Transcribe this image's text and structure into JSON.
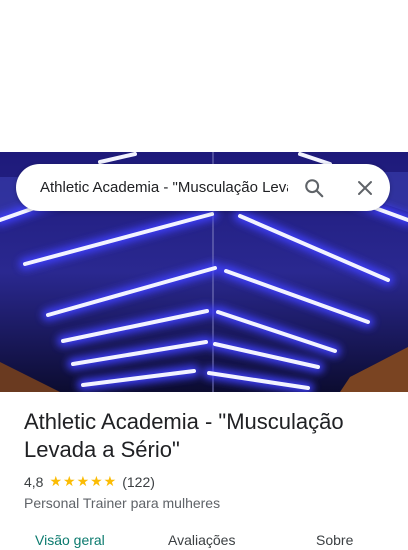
{
  "search": {
    "query": "Athletic Academia - \"Musculação Levada a Sério\""
  },
  "place": {
    "title": "Athletic Academia - \"Musculação Levada a Sério\"",
    "rating": "4,8",
    "stars": "★★★★★",
    "reviews_count": "(122)",
    "category": "Personal Trainer para mulheres"
  },
  "tabs": [
    {
      "label": "Visão geral",
      "active": true
    },
    {
      "label": "Avaliações",
      "active": false
    },
    {
      "label": "Sobre",
      "active": false
    }
  ],
  "colors": {
    "accent": "#0b7a6e",
    "star": "#fbbc04",
    "neon": "#5a5cff"
  }
}
